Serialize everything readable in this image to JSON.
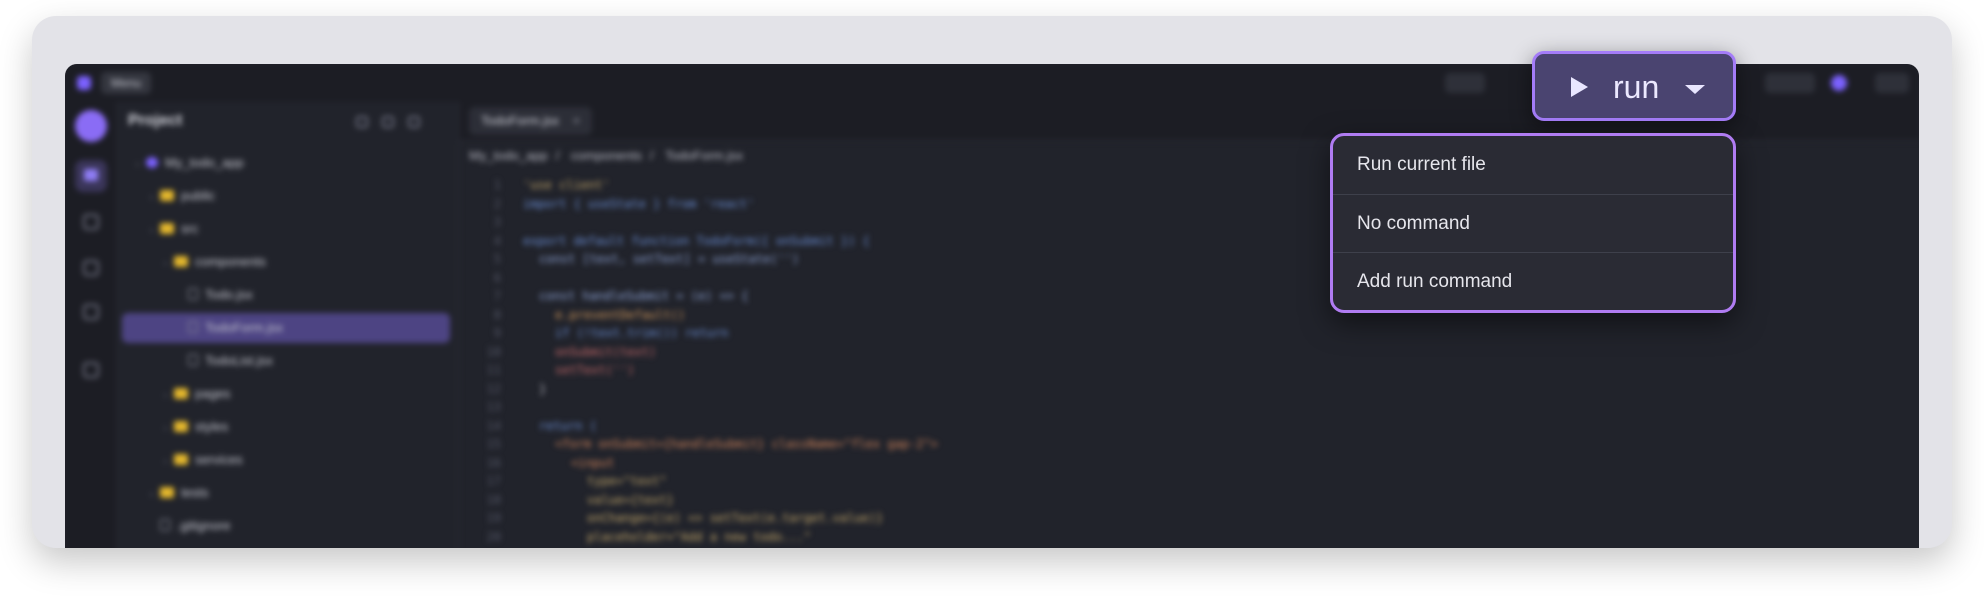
{
  "ide": {
    "menu_label": "Menu",
    "sidebar_title": "Project",
    "tree": [
      {
        "label": "My_todo_app",
        "kind": "root",
        "depth": 1
      },
      {
        "label": "public",
        "kind": "folder",
        "depth": 2
      },
      {
        "label": "src",
        "kind": "folder",
        "depth": 2
      },
      {
        "label": "components",
        "kind": "folder",
        "depth": 3
      },
      {
        "label": "Todo.jsx",
        "kind": "file",
        "depth": 4
      },
      {
        "label": "TodoForm.jsx",
        "kind": "file",
        "depth": 4,
        "active": true
      },
      {
        "label": "TodoList.jsx",
        "kind": "file",
        "depth": 4
      },
      {
        "label": "pages",
        "kind": "folder",
        "depth": 3
      },
      {
        "label": "styles",
        "kind": "folder",
        "depth": 3
      },
      {
        "label": "services",
        "kind": "folder",
        "depth": 3
      },
      {
        "label": "tests",
        "kind": "folder",
        "depth": 2
      },
      {
        "label": ".gitignore",
        "kind": "file",
        "depth": 2
      }
    ],
    "tab_label": "TodoForm.jsx",
    "breadcrumb": [
      "My_todo_app",
      "components",
      "TodoForm.jsx"
    ],
    "code_lines": [
      {
        "n": "1",
        "t": "'use client'",
        "c": "#c3a76a",
        "i": 0
      },
      {
        "n": "2",
        "t": "import { useState } from 'react'",
        "c": "#6b8fd6",
        "i": 0
      },
      {
        "n": "3",
        "t": "",
        "c": "#ffffff",
        "i": 0
      },
      {
        "n": "4",
        "t": "export default function TodoForm({ onSubmit }) {",
        "c": "#6b8fd6",
        "i": 0
      },
      {
        "n": "5",
        "t": "const [text, setText] = useState('')",
        "c": "#8fa5d8",
        "i": 1
      },
      {
        "n": "6",
        "t": "",
        "c": "#ffffff",
        "i": 0
      },
      {
        "n": "7",
        "t": "const handleSubmit = (e) => {",
        "c": "#8fa5d8",
        "i": 1
      },
      {
        "n": "8",
        "t": "e.preventDefault()",
        "c": "#d49a5c",
        "i": 2
      },
      {
        "n": "9",
        "t": "if (!text.trim()) return",
        "c": "#6b8fd6",
        "i": 2
      },
      {
        "n": "10",
        "t": "onSubmit(text)",
        "c": "#c86a6a",
        "i": 2
      },
      {
        "n": "11",
        "t": "setText('')",
        "c": "#c86a6a",
        "i": 2
      },
      {
        "n": "12",
        "t": "}",
        "c": "#b8b9c3",
        "i": 1
      },
      {
        "n": "13",
        "t": "",
        "c": "#ffffff",
        "i": 0
      },
      {
        "n": "14",
        "t": "return (",
        "c": "#6b8fd6",
        "i": 1
      },
      {
        "n": "15",
        "t": "<form onSubmit={handleSubmit} className=\"flex gap-2\">",
        "c": "#d0845a",
        "i": 2
      },
      {
        "n": "16",
        "t": "<input",
        "c": "#d0845a",
        "i": 3
      },
      {
        "n": "17",
        "t": "type=\"text\"",
        "c": "#c3a76a",
        "i": 4
      },
      {
        "n": "18",
        "t": "value={text}",
        "c": "#c3a76a",
        "i": 4
      },
      {
        "n": "19",
        "t": "onChange={(e) => setText(e.target.value)}",
        "c": "#c3a76a",
        "i": 4
      },
      {
        "n": "20",
        "t": "placeholder=\"Add a new todo...\"",
        "c": "#c3a76a",
        "i": 4
      }
    ]
  },
  "run_button": {
    "label": "run"
  },
  "run_menu": {
    "items": [
      {
        "label": "Run current file"
      },
      {
        "label": "No command"
      },
      {
        "label": "Add run command"
      }
    ]
  }
}
